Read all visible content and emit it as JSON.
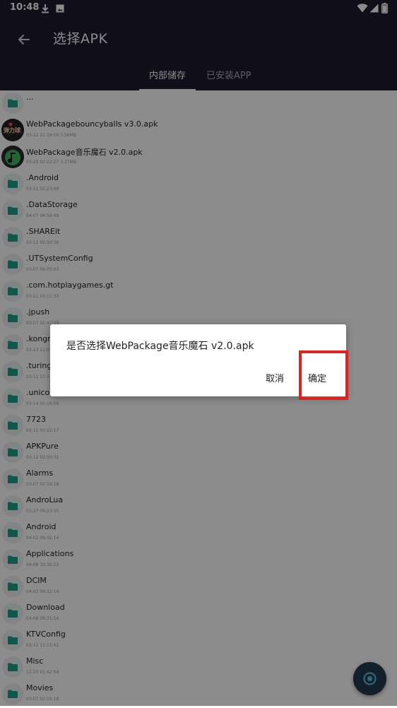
{
  "status_bar": {
    "time": "10:48",
    "left_icons": [
      "download-icon",
      "image-icon"
    ],
    "right_icons": [
      "wifi-icon",
      "signal-icon",
      "battery-icon"
    ]
  },
  "appbar": {
    "title": "选择APK",
    "back_icon": "arrow-left-icon"
  },
  "tabs": [
    {
      "label": "内部储存",
      "active": true
    },
    {
      "label": "已安装APP",
      "active": false
    }
  ],
  "files": [
    {
      "name": "...",
      "meta": "",
      "icon": "folder-icon"
    },
    {
      "name": "WebPackagebouncyballs v3.0.apk",
      "meta": "03-12 11:19:56  3.56MB",
      "icon": "apk-bouncyballs-icon"
    },
    {
      "name": "WebPackage音乐魔石 v2.0.apk",
      "meta": "03-29 02:22:27  3.37MB",
      "icon": "apk-music-icon"
    },
    {
      "name": ".Android",
      "meta": "03-11 02:23:08",
      "icon": "folder-icon"
    },
    {
      "name": ".DataStorage",
      "meta": "04-07 04:56:49",
      "icon": "folder-icon"
    },
    {
      "name": ".SHAREit",
      "meta": "03-12 02:50:36",
      "icon": "folder-icon"
    },
    {
      "name": ".UTSystemConfig",
      "meta": "03-07 06:05:03",
      "icon": "folder-icon"
    },
    {
      "name": ".com.hotplaygames.gt",
      "meta": "03-11 03:11:33",
      "icon": "folder-icon"
    },
    {
      "name": ".jpush",
      "meta": "03-07 02:47:33",
      "icon": "folder-icon"
    },
    {
      "name": ".kongregate",
      "meta": "03-13 11:04:23",
      "icon": "folder-icon"
    },
    {
      "name": ".turingentity",
      "meta": "03-11 11:24:36",
      "icon": "folder-icon"
    },
    {
      "name": ".unicomstore",
      "meta": "03-14 05:16:06",
      "icon": "folder-icon"
    },
    {
      "name": "7723",
      "meta": "03-11 03:22:17",
      "icon": "folder-icon"
    },
    {
      "name": "APKPure",
      "meta": "03-12 02:50:31",
      "icon": "folder-icon"
    },
    {
      "name": "Alarms",
      "meta": "03-07 02:19:18",
      "icon": "folder-icon"
    },
    {
      "name": "AndroLua",
      "meta": "03-27 09:23:35",
      "icon": "folder-icon"
    },
    {
      "name": "Android",
      "meta": "04-02 09:32:14",
      "icon": "folder-icon"
    },
    {
      "name": "Applications",
      "meta": "04-08 10:36:23",
      "icon": "folder-icon"
    },
    {
      "name": "DCIM",
      "meta": "04-02 09:32:14",
      "icon": "folder-icon"
    },
    {
      "name": "Download",
      "meta": "04-08 09:31:54",
      "icon": "folder-icon"
    },
    {
      "name": "KTVConfig",
      "meta": "03-12 11:11:41",
      "icon": "folder-icon"
    },
    {
      "name": "Misc",
      "meta": "12-20 01:42:04",
      "icon": "folder-icon"
    },
    {
      "name": "Movies",
      "meta": "03-07 02:15:18",
      "icon": "folder-icon"
    }
  ],
  "dialog": {
    "message": "是否选择WebPackage音乐魔石 v2.0.apk",
    "cancel_label": "取消",
    "confirm_label": "确定"
  },
  "apk_icon_text": "弹力球",
  "fab": {
    "icon": "search-icon"
  },
  "colors": {
    "header_bg": "#1e1a2e",
    "folder": "#1aa086",
    "highlight": "#e3201e"
  }
}
